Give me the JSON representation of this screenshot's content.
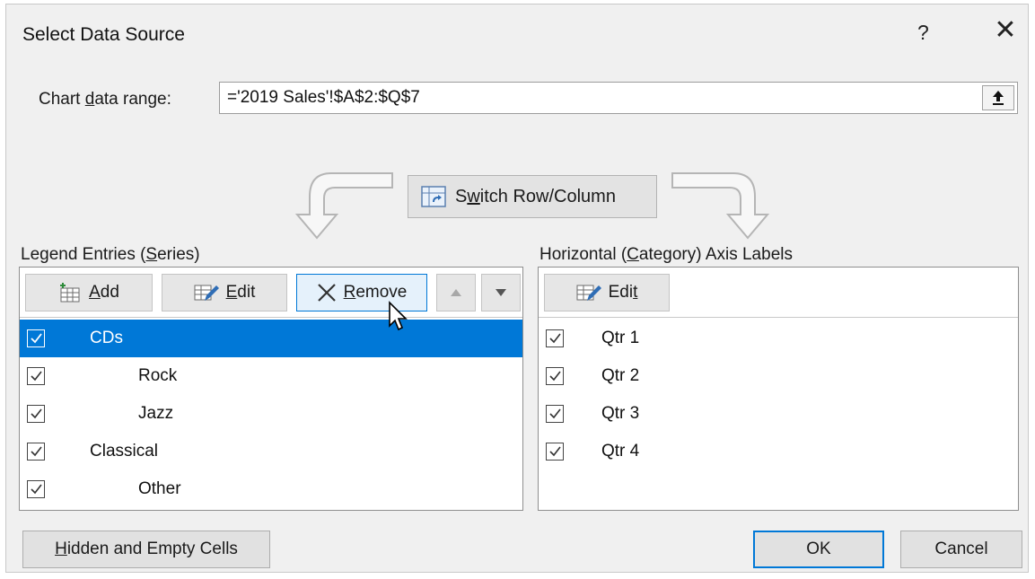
{
  "dialog": {
    "title": "Select Data Source",
    "help_label": "?",
    "close_label": "✕"
  },
  "range": {
    "label_pre": "Chart ",
    "label_key": "d",
    "label_post": "ata range:",
    "value": "='2019 Sales'!$A$2:$Q$7",
    "collapse_icon": "upload-arrow-icon"
  },
  "switch_button": {
    "pre": "S",
    "key": "w",
    "post": "itch Row/Column",
    "icon": "switch-row-column-icon"
  },
  "legend": {
    "label_pre": "Legend Entries (",
    "label_key": "S",
    "label_post": "eries)",
    "buttons": {
      "add_key": "A",
      "add_rest": "dd",
      "edit_key": "E",
      "edit_rest": "dit",
      "remove_key": "R",
      "remove_rest": "emove"
    },
    "items": [
      {
        "label": "CDs",
        "checked": true,
        "selected": true
      },
      {
        "label": "Rock",
        "checked": true,
        "selected": false
      },
      {
        "label": "Jazz",
        "checked": true,
        "selected": false
      },
      {
        "label": "Classical",
        "checked": true,
        "selected": false
      },
      {
        "label": "Other",
        "checked": true,
        "selected": false
      }
    ]
  },
  "axis": {
    "label_pre": "Horizontal (",
    "label_key": "C",
    "label_post": "ategory) Axis Labels",
    "edit_pre": "Edi",
    "edit_key": "t",
    "items": [
      {
        "label": "Qtr 1",
        "checked": true
      },
      {
        "label": "Qtr 2",
        "checked": true
      },
      {
        "label": "Qtr 3",
        "checked": true
      },
      {
        "label": "Qtr 4",
        "checked": true
      }
    ]
  },
  "footer": {
    "hidden_key": "H",
    "hidden_rest": "idden and Empty Cells",
    "ok_label": "OK",
    "cancel_label": "Cancel"
  },
  "colors": {
    "selection": "#0078d7",
    "dialog_bg": "#f0f0f0"
  }
}
